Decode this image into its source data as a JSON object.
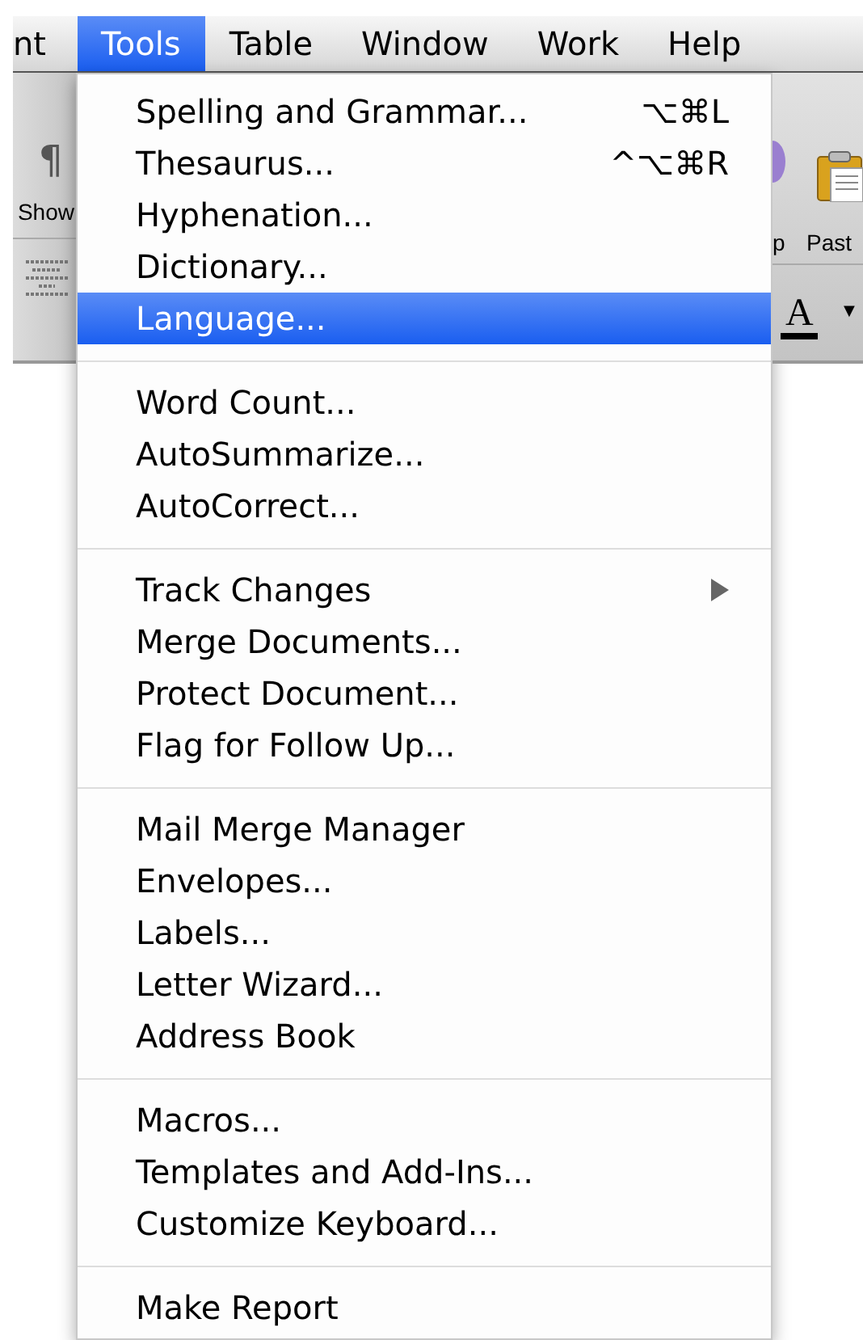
{
  "menubar": [
    {
      "label": "nt",
      "selected": false
    },
    {
      "label": "Tools",
      "selected": true
    },
    {
      "label": "Table",
      "selected": false
    },
    {
      "label": "Window",
      "selected": false
    },
    {
      "label": "Work",
      "selected": false
    },
    {
      "label": "Help",
      "selected": false
    }
  ],
  "toolbar_left": {
    "pilcrow": "¶",
    "label": "Show"
  },
  "toolbar_right": {
    "label_1": "p",
    "label_2": "Past",
    "font_color": "A",
    "caret": "▼"
  },
  "menu": [
    [
      {
        "label": "Spelling and Grammar...",
        "shortcut": "⌥⌘L",
        "selected": false
      },
      {
        "label": "Thesaurus...",
        "shortcut": "^⌥⌘R",
        "selected": false
      },
      {
        "label": "Hyphenation...",
        "selected": false
      },
      {
        "label": "Dictionary...",
        "selected": false
      },
      {
        "label": "Language...",
        "selected": true
      }
    ],
    [
      {
        "label": "Word Count...",
        "selected": false
      },
      {
        "label": "AutoSummarize...",
        "selected": false
      },
      {
        "label": "AutoCorrect...",
        "selected": false
      }
    ],
    [
      {
        "label": "Track Changes",
        "submenu": true,
        "selected": false
      },
      {
        "label": "Merge Documents...",
        "selected": false
      },
      {
        "label": "Protect Document...",
        "selected": false
      },
      {
        "label": "Flag for Follow Up...",
        "selected": false
      }
    ],
    [
      {
        "label": "Mail Merge Manager",
        "selected": false
      },
      {
        "label": "Envelopes...",
        "selected": false
      },
      {
        "label": "Labels...",
        "selected": false
      },
      {
        "label": "Letter Wizard...",
        "selected": false
      },
      {
        "label": "Address Book",
        "selected": false
      }
    ],
    [
      {
        "label": "Macros...",
        "selected": false
      },
      {
        "label": "Templates and Add-Ins...",
        "selected": false
      },
      {
        "label": "Customize Keyboard...",
        "selected": false
      }
    ],
    [
      {
        "label": "Make Report",
        "selected": false
      }
    ]
  ]
}
